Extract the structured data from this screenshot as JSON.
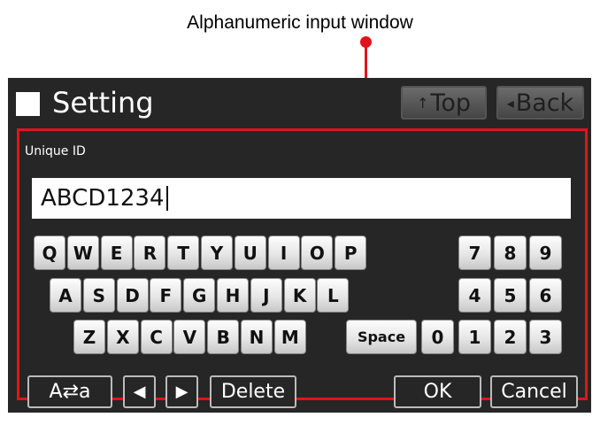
{
  "caption": "Alphanumeric input window",
  "header": {
    "title": "Setting",
    "top_label": "Top",
    "back_label": "Back",
    "top_icon": "up-arrow-icon",
    "back_icon": "left-triangle-icon"
  },
  "field": {
    "label": "Unique ID",
    "value": "ABCD1234"
  },
  "keyboard": {
    "row1": [
      "Q",
      "W",
      "E",
      "R",
      "T",
      "Y",
      "U",
      "I",
      "O",
      "P"
    ],
    "row2": [
      "A",
      "S",
      "D",
      "F",
      "G",
      "H",
      "J",
      "K",
      "L"
    ],
    "row3": [
      "Z",
      "X",
      "C",
      "V",
      "B",
      "N",
      "M"
    ],
    "space": "Space",
    "numpad": [
      "7",
      "8",
      "9",
      "4",
      "5",
      "6",
      "0",
      "1",
      "2",
      "3"
    ]
  },
  "actions": {
    "case_toggle": "A⇄a",
    "left_arrow": "◀",
    "right_arrow": "▶",
    "delete": "Delete",
    "ok": "OK",
    "cancel": "Cancel"
  },
  "colors": {
    "highlight": "#e0141c",
    "screen_bg": "#262626"
  }
}
